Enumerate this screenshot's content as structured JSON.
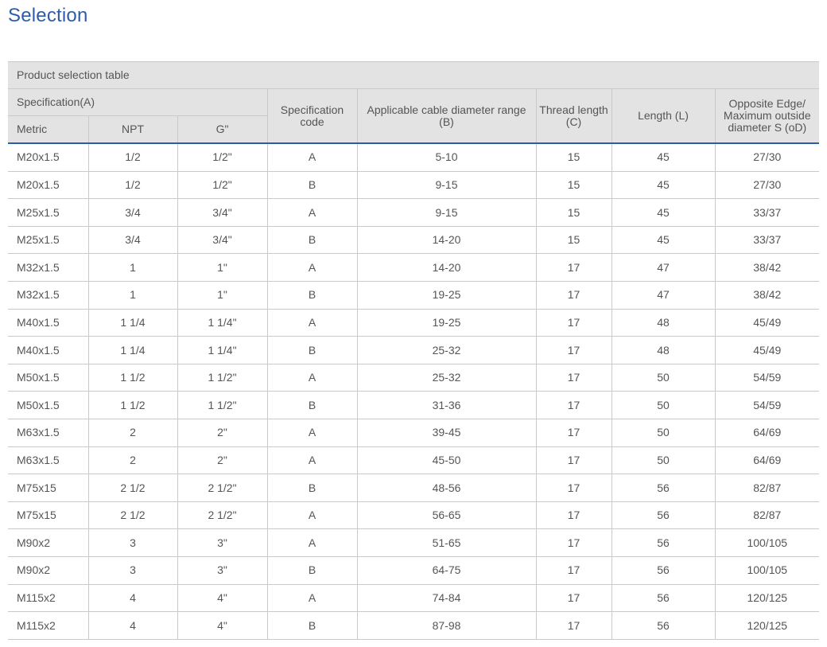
{
  "page": {
    "title": "Selection"
  },
  "table": {
    "caption": "Product selection table",
    "group_header": "Specification(A)",
    "sub_headers": [
      "Metric",
      "NPT",
      "G\""
    ],
    "headers": {
      "code": [
        "Specification",
        "code"
      ],
      "cable": [
        "Applicable cable diameter range",
        "(B)"
      ],
      "thread": [
        "Thread length",
        "(C)"
      ],
      "length": "Length  (L)",
      "opposite": [
        "Opposite Edge/",
        "Maximum outside",
        "diameter S (oD)"
      ]
    },
    "rows": [
      [
        "M20x1.5",
        "1/2",
        "1/2\"",
        "A",
        "5-10",
        "15",
        "45",
        "27/30"
      ],
      [
        "M20x1.5",
        "1/2",
        "1/2\"",
        "B",
        "9-15",
        "15",
        "45",
        "27/30"
      ],
      [
        "M25x1.5",
        "3/4",
        "3/4\"",
        "A",
        "9-15",
        "15",
        "45",
        "33/37"
      ],
      [
        "M25x1.5",
        "3/4",
        "3/4\"",
        "B",
        "14-20",
        "15",
        "45",
        "33/37"
      ],
      [
        "M32x1.5",
        "1",
        "1\"",
        "A",
        "14-20",
        "17",
        "47",
        "38/42"
      ],
      [
        "M32x1.5",
        "1",
        "1\"",
        "B",
        "19-25",
        "17",
        "47",
        "38/42"
      ],
      [
        "M40x1.5",
        "1 1/4",
        "1 1/4\"",
        "A",
        "19-25",
        "17",
        "48",
        "45/49"
      ],
      [
        "M40x1.5",
        "1 1/4",
        "1 1/4\"",
        "B",
        "25-32",
        "17",
        "48",
        "45/49"
      ],
      [
        "M50x1.5",
        "1 1/2",
        "1 1/2\"",
        "A",
        "25-32",
        "17",
        "50",
        "54/59"
      ],
      [
        "M50x1.5",
        "1 1/2",
        "1 1/2\"",
        "B",
        "31-36",
        "17",
        "50",
        "54/59"
      ],
      [
        "M63x1.5",
        "2",
        "2\"",
        "A",
        "39-45",
        "17",
        "50",
        "64/69"
      ],
      [
        "M63x1.5",
        "2",
        "2\"",
        "A",
        "45-50",
        "17",
        "50",
        "64/69"
      ],
      [
        "M75x15",
        "2 1/2",
        "2 1/2\"",
        "B",
        "48-56",
        "17",
        "56",
        "82/87"
      ],
      [
        "M75x15",
        "2 1/2",
        "2 1/2\"",
        "A",
        "56-65",
        "17",
        "56",
        "82/87"
      ],
      [
        "M90x2",
        "3",
        "3\"",
        "A",
        "51-65",
        "17",
        "56",
        "100/105"
      ],
      [
        "M90x2",
        "3",
        "3\"",
        "B",
        "64-75",
        "17",
        "56",
        "100/105"
      ],
      [
        "M115x2",
        "4",
        "4\"",
        "A",
        "74-84",
        "17",
        "56",
        "120/125"
      ],
      [
        "M115x2",
        "4",
        "4\"",
        "B",
        "87-98",
        "17",
        "56",
        "120/125"
      ]
    ]
  },
  "colors": {
    "title": "#2f5ca8",
    "header_bg": "#e3e3e3",
    "rule": "#2f5ca8",
    "border": "#c9c9c9"
  }
}
